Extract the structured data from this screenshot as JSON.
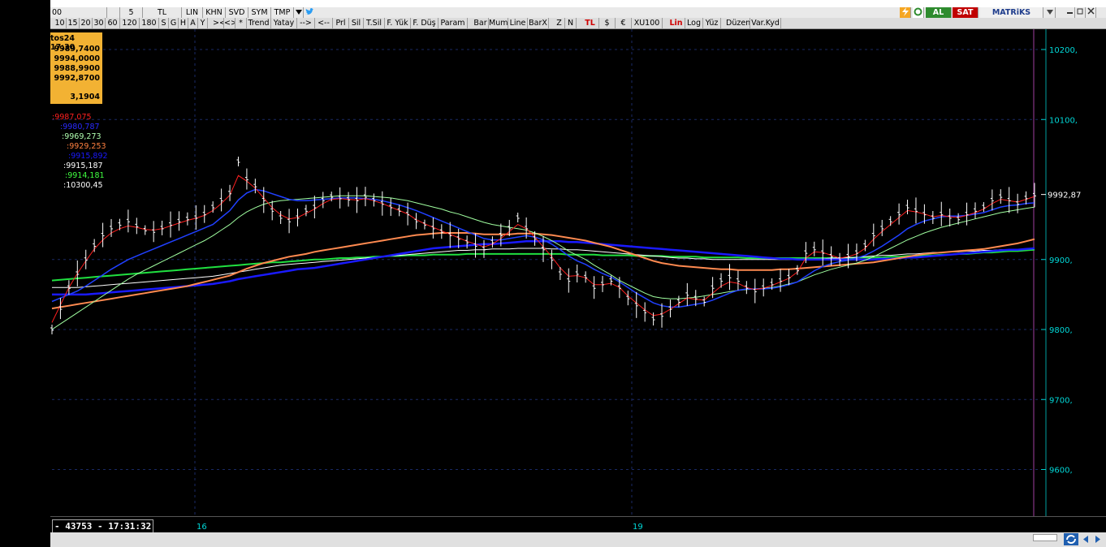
{
  "toolbar_top": {
    "items": [
      "00",
      "5",
      "TL",
      "LIN",
      "KHN",
      "SVD",
      "SYM",
      "TMP"
    ],
    "brand": "MATRiKS",
    "buy_label": "AL",
    "sell_label": "SAT"
  },
  "toolbar_bottom": {
    "periods": [
      "10",
      "15",
      "20",
      "30",
      "60",
      "120",
      "180",
      "S",
      "G",
      "H",
      "A",
      "Y"
    ],
    "tools": [
      "><",
      "<>",
      "*",
      "Trend",
      "Yatay",
      "-->",
      "<--",
      "Prl",
      "Sil",
      "T.Sil",
      "F. Yük",
      "F. Düş",
      "Param",
      "Bar",
      "Mum",
      "Line",
      "BarX",
      "Z",
      "N",
      "TL",
      "$",
      "€",
      "XU100",
      "Lin",
      "Log",
      "Yüz",
      "Düzen",
      "Var.Kyd"
    ]
  },
  "info_box": {
    "date": "tos24 17:30",
    "open": "9989,7400",
    "high": "9994,0000",
    "low": "9988,9900",
    "close": "9992,8700",
    "change": "3,1904"
  },
  "indicators": [
    {
      "value": ":9987,075",
      "color": "#ff2020"
    },
    {
      "value": ":9980,787",
      "color": "#2a2aff"
    },
    {
      "value": ":9969,273",
      "color": "#b0ffb0"
    },
    {
      "value": ":9929,253",
      "color": "#ff8040"
    },
    {
      "value": ":9915,892",
      "color": "#1a1aff"
    },
    {
      "value": ":9915,187",
      "color": "#ffffff"
    },
    {
      "value": ":9914,181",
      "color": "#40ff40"
    },
    {
      "value": ":10300,45",
      "color": "#ffffff"
    }
  ],
  "status": {
    "text": "- 43753 - 17:31:32"
  },
  "x_labels": [
    "16",
    "19"
  ],
  "chart_data": {
    "type": "line",
    "ylim": [
      9560,
      10250
    ],
    "yticks": [
      "10200,",
      "10100,",
      "9900,",
      "9800,",
      "9700,",
      "9600,"
    ],
    "ytick_values": [
      10200,
      10100,
      9900,
      9800,
      9700,
      9600
    ],
    "last_price_label": "9992,87",
    "last_price": 9992.87,
    "price": [
      9800,
      9830,
      9860,
      9880,
      9900,
      9920,
      9935,
      9945,
      9950,
      9955,
      9948,
      9942,
      9940,
      9945,
      9950,
      9955,
      9958,
      9960,
      9965,
      9975,
      9985,
      9995,
      10040,
      10015,
      10005,
      9985,
      9970,
      9960,
      9955,
      9960,
      9970,
      9975,
      9985,
      9990,
      9988,
      9986,
      9985,
      9990,
      9985,
      9980,
      9975,
      9970,
      9965,
      9955,
      9950,
      9945,
      9940,
      9935,
      9930,
      9925,
      9920,
      9915,
      9925,
      9935,
      9945,
      9960,
      9945,
      9930,
      9915,
      9900,
      9880,
      9870,
      9880,
      9875,
      9860,
      9865,
      9870,
      9860,
      9845,
      9835,
      9825,
      9815,
      9820,
      9830,
      9840,
      9850,
      9845,
      9840,
      9860,
      9870,
      9875,
      9870,
      9860,
      9855,
      9860,
      9865,
      9870,
      9875,
      9885,
      9910,
      9915,
      9910,
      9905,
      9900,
      9905,
      9910,
      9920,
      9935,
      9945,
      9955,
      9965,
      9975,
      9970,
      9965,
      9960,
      9965,
      9960,
      9958,
      9965,
      9970,
      9975,
      9985,
      9990,
      9985,
      9980,
      9988,
      9992
    ],
    "ma_fast": [
      9810,
      9835,
      9860,
      9880,
      9898,
      9915,
      9928,
      9938,
      9944,
      9948,
      9946,
      9943,
      9942,
      9944,
      9948,
      9952,
      9956,
      9959,
      9963,
      9970,
      9980,
      9992,
      10020,
      10012,
      10002,
      9988,
      9974,
      9964,
      9958,
      9960,
      9966,
      9972,
      9980,
      9986,
      9987,
      9986,
      9985,
      9987,
      9984,
      9980,
      9975,
      9970,
      9965,
      9957,
      9951,
      9946,
      9941,
      9936,
      9931,
      9926,
      9922,
      9918,
      9922,
      9930,
      9940,
      9950,
      9944,
      9932,
      9918,
      9904,
      9888,
      9876,
      9877,
      9874,
      9864,
      9864,
      9866,
      9860,
      9848,
      9838,
      9828,
      9820,
      9822,
      9829,
      9837,
      9845,
      9843,
      9842,
      9852,
      9862,
      9868,
      9866,
      9860,
      9857,
      9859,
      9863,
      9868,
      9873,
      9882,
      9902,
      9911,
      9910,
      9906,
      9902,
      9904,
      9908,
      9916,
      9929,
      9940,
      9950,
      9960,
      9970,
      9968,
      9965,
      9961,
      9963,
      9961,
      9960,
      9963,
      9967,
      9972,
      9980,
      9986,
      9984,
      9982,
      9986,
      9990
    ],
    "ma_blue": [
      9840,
      9845,
      9850,
      9855,
      9862,
      9870,
      9878,
      9886,
      9893,
      9900,
      9905,
      9910,
      9915,
      9920,
      9925,
      9930,
      9935,
      9940,
      9945,
      9950,
      9960,
      9970,
      9985,
      9995,
      10000,
      9998,
      9994,
      9990,
      9986,
      9984,
      9984,
      9985,
      9986,
      9987,
      9988,
      9988,
      9988,
      9987,
      9986,
      9984,
      9981,
      9978,
      9974,
      9970,
      9965,
      9960,
      9955,
      9950,
      9945,
      9940,
      9935,
      9930,
      9928,
      9928,
      9930,
      9932,
      9934,
      9932,
      9928,
      9922,
      9914,
      9905,
      9898,
      9893,
      9886,
      9880,
      9875,
      9868,
      9860,
      9852,
      9845,
      9838,
      9834,
      9832,
      9832,
      9834,
      9836,
      9838,
      9842,
      9847,
      9852,
      9856,
      9858,
      9858,
      9858,
      9859,
      9861,
      9864,
      9868,
      9876,
      9884,
      9890,
      9894,
      9897,
      9899,
      9902,
      9906,
      9912,
      9919,
      9927,
      9935,
      9944,
      9950,
      9955,
      9958,
      9961,
      9962,
      9962,
      9963,
      9965,
      9967,
      9971,
      9975,
      9977,
      9978,
      9980,
      9981
    ],
    "ma_lightgreen": [
      9800,
      9808,
      9816,
      9824,
      9832,
      9840,
      9848,
      9856,
      9864,
      9872,
      9879,
      9885,
      9891,
      9897,
      9903,
      9909,
      9915,
      9921,
      9927,
      9934,
      9942,
      9950,
      9960,
      9968,
      9974,
      9979,
      9982,
      9984,
      9985,
      9986,
      9987,
      9988,
      9989,
      9990,
      9991,
      9991,
      9991,
      9991,
      9990,
      9989,
      9988,
      9986,
      9984,
      9981,
      9978,
      9975,
      9972,
      9968,
      9965,
      9961,
      9957,
      9953,
      9950,
      9948,
      9946,
      9944,
      9942,
      9938,
      9933,
      9927,
      9920,
      9912,
      9906,
      9900,
      9892,
      9885,
      9878,
      9870,
      9864,
      9858,
      9852,
      9847,
      9845,
      9844,
      9844,
      9845,
      9846,
      9848,
      9850,
      9852,
      9854,
      9856,
      9857,
      9858,
      9859,
      9860,
      9862,
      9865,
      9868,
      9873,
      9878,
      9882,
      9886,
      9889,
      9892,
      9895,
      9899,
      9904,
      9910,
      9916,
      9922,
      9928,
      9933,
      9938,
      9942,
      9946,
      9949,
      9952,
      9955,
      9958,
      9961,
      9964,
      9967,
      9969,
      9971,
      9973,
      9975
    ],
    "ma_orange": [
      9830,
      9832,
      9834,
      9836,
      9838,
      9840,
      9842,
      9844,
      9846,
      9848,
      9850,
      9852,
      9854,
      9856,
      9858,
      9860,
      9862,
      9865,
      9868,
      9871,
      9874,
      9877,
      9882,
      9887,
      9891,
      9895,
      9898,
      9901,
      9904,
      9906,
      9908,
      9911,
      9913,
      9915,
      9917,
      9919,
      9921,
      9923,
      9925,
      9927,
      9929,
      9931,
      9933,
      9935,
      9936,
      9937,
      9938,
      9938,
      9938,
      9938,
      9937,
      9936,
      9936,
      9936,
      9936,
      9937,
      9937,
      9937,
      9936,
      9935,
      9933,
      9931,
      9929,
      9927,
      9924,
      9921,
      9918,
      9914,
      9910,
      9906,
      9902,
      9898,
      9895,
      9893,
      9891,
      9890,
      9889,
      9888,
      9887,
      9886,
      9886,
      9885,
      9885,
      9885,
      9885,
      9885,
      9886,
      9886,
      9887,
      9888,
      9889,
      9890,
      9891,
      9892,
      9893,
      9894,
      9895,
      9896,
      9898,
      9900,
      9902,
      9904,
      9906,
      9908,
      9909,
      9910,
      9911,
      9912,
      9913,
      9914,
      9915,
      9917,
      9919,
      9921,
      9923,
      9926,
      9929
    ],
    "ma_darkblue": [
      9850,
      9850,
      9850,
      9850,
      9850,
      9851,
      9852,
      9853,
      9854,
      9855,
      9856,
      9857,
      9858,
      9859,
      9860,
      9861,
      9862,
      9863,
      9864,
      9865,
      9867,
      9869,
      9872,
      9874,
      9876,
      9878,
      9880,
      9882,
      9884,
      9886,
      9887,
      9888,
      9890,
      9892,
      9894,
      9896,
      9898,
      9900,
      9902,
      9904,
      9906,
      9908,
      9910,
      9912,
      9914,
      9916,
      9917,
      9918,
      9919,
      9920,
      9921,
      9922,
      9922,
      9923,
      9924,
      9925,
      9926,
      9926,
      9926,
      9926,
      9926,
      9925,
      9925,
      9924,
      9923,
      9922,
      9921,
      9920,
      9919,
      9918,
      9917,
      9916,
      9915,
      9914,
      9913,
      9912,
      9911,
      9910,
      9909,
      9908,
      9907,
      9906,
      9905,
      9904,
      9903,
      9902,
      9901,
      9901,
      9900,
      9900,
      9900,
      9900,
      9900,
      9900,
      9900,
      9900,
      9900,
      9900,
      9901,
      9901,
      9902,
      9903,
      9903,
      9904,
      9905,
      9906,
      9907,
      9908,
      9909,
      9910,
      9911,
      9912,
      9913,
      9914,
      9914,
      9915,
      9916
    ],
    "ma_white": [
      9860,
      9860,
      9860,
      9860,
      9861,
      9862,
      9863,
      9864,
      9865,
      9866,
      9867,
      9868,
      9869,
      9870,
      9871,
      9872,
      9873,
      9874,
      9875,
      9876,
      9878,
      9880,
      9882,
      9884,
      9886,
      9888,
      9890,
      9892,
      9893,
      9894,
      9895,
      9896,
      9897,
      9898,
      9899,
      9900,
      9901,
      9902,
      9903,
      9904,
      9905,
      9906,
      9907,
      9908,
      9909,
      9910,
      9911,
      9912,
      9913,
      9913,
      9914,
      9914,
      9915,
      9915,
      9915,
      9916,
      9916,
      9916,
      9916,
      9915,
      9915,
      9914,
      9914,
      9913,
      9912,
      9911,
      9910,
      9909,
      9908,
      9907,
      9906,
      9905,
      9904,
      9903,
      9902,
      9902,
      9901,
      9901,
      9900,
      9900,
      9900,
      9900,
      9900,
      9900,
      9900,
      9900,
      9900,
      9900,
      9900,
      9900,
      9901,
      9901,
      9902,
      9902,
      9903,
      9903,
      9904,
      9905,
      9906,
      9906,
      9907,
      9908,
      9908,
      9909,
      9910,
      9910,
      9911,
      9911,
      9912,
      9912,
      9913,
      9913,
      9914,
      9914,
      9914,
      9915,
      9915
    ],
    "ma_green": [
      9870,
      9871,
      9872,
      9873,
      9874,
      9875,
      9876,
      9877,
      9878,
      9879,
      9880,
      9881,
      9882,
      9883,
      9884,
      9885,
      9886,
      9887,
      9888,
      9889,
      9890,
      9891,
      9892,
      9893,
      9894,
      9895,
      9896,
      9896,
      9897,
      9898,
      9899,
      9900,
      9900,
      9901,
      9902,
      9902,
      9903,
      9903,
      9904,
      9904,
      9905,
      9905,
      9906,
      9906,
      9906,
      9907,
      9907,
      9907,
      9907,
      9908,
      9908,
      9908,
      9908,
      9908,
      9908,
      9908,
      9908,
      9908,
      9908,
      9908,
      9908,
      9907,
      9907,
      9907,
      9907,
      9906,
      9906,
      9906,
      9906,
      9905,
      9905,
      9905,
      9905,
      9904,
      9904,
      9904,
      9904,
      9903,
      9903,
      9903,
      9903,
      9903,
      9902,
      9902,
      9902,
      9902,
      9902,
      9902,
      9902,
      9902,
      9902,
      9902,
      9902,
      9902,
      9902,
      9903,
      9903,
      9903,
      9903,
      9904,
      9904,
      9905,
      9905,
      9906,
      9906,
      9907,
      9907,
      9908,
      9908,
      9909,
      9910,
      9910,
      9911,
      9912,
      9912,
      9913,
      9914
    ]
  }
}
